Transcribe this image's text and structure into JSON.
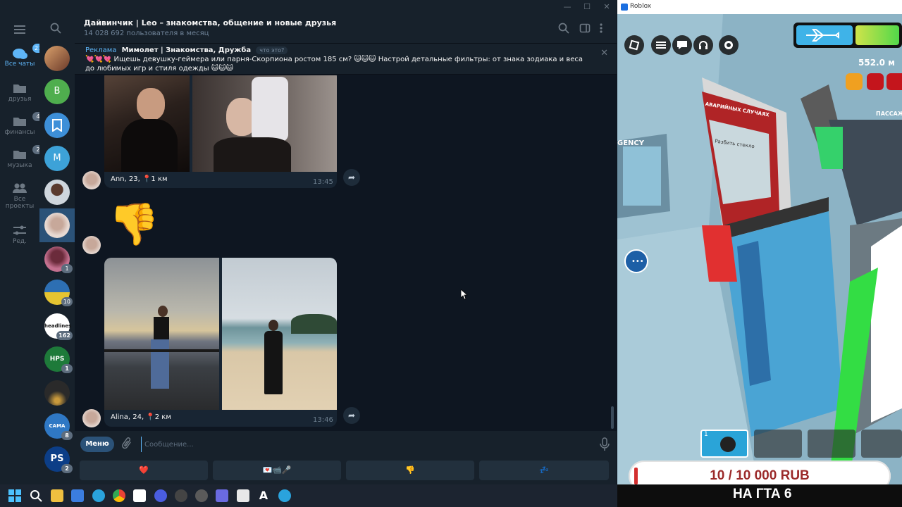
{
  "telegram": {
    "folders": [
      {
        "label": "Все чаты",
        "badge": "21",
        "icon": "chat-bubbles-icon",
        "active": true
      },
      {
        "label": "друзья",
        "badge": "",
        "icon": "folder-icon"
      },
      {
        "label": "финансы",
        "badge": "4",
        "icon": "folder-icon"
      },
      {
        "label": "музыка",
        "badge": "2",
        "icon": "folder-icon"
      },
      {
        "label": "Все проекты",
        "badge": "",
        "icon": "people-icon"
      },
      {
        "label": "Ред.",
        "badge": "",
        "icon": "sliders-icon"
      }
    ],
    "chat_list": [
      {
        "initial": "",
        "badge": "",
        "color": "#a0522d"
      },
      {
        "initial": "B",
        "badge": "",
        "color": "#4fae4e"
      },
      {
        "initial": "",
        "badge": "",
        "color": "#3d8fd8"
      },
      {
        "initial": "M",
        "badge": "",
        "color": "#3da2d8"
      },
      {
        "initial": "",
        "badge": "",
        "color": "#8a6b5a"
      },
      {
        "initial": "",
        "badge": "",
        "color": "#b9a59c"
      },
      {
        "initial": "",
        "badge": "1",
        "color": "#7a3b5e"
      },
      {
        "initial": "",
        "badge": "10",
        "color": "#2d6fb3"
      },
      {
        "initial": "headlines",
        "badge": "162",
        "color": "#ffffff"
      },
      {
        "initial": "HPS",
        "badge": "1",
        "color": "#1e7a3a"
      },
      {
        "initial": "",
        "badge": "",
        "color": "#3a3a3a"
      },
      {
        "initial": "CAMA",
        "badge": "8",
        "color": "#2f78c4"
      },
      {
        "initial": "PS",
        "badge": "2",
        "color": "#0c3e87"
      }
    ],
    "header": {
      "title": "Дайвинчик | Leo – знакомства, общение и новые друзья",
      "subtitle": "14 028 692 пользователя в месяц"
    },
    "ad": {
      "tag": "Реклама",
      "name": "Мимолет | Знакомства, Дружба",
      "what": "что это?",
      "text": "💘💘💘 Ищешь девушку-геймера или парня-Скорпиона ростом 185 см? 🐱🐱🐱 Настрой детальные фильтры: от знака зодиака и веса до любимых игр и стиля одежды 🐱🐱🐱"
    },
    "messages": [
      {
        "caption": "Ann, 23, 📍1 км",
        "time": "13:45"
      },
      {
        "emoji": "👎"
      },
      {
        "caption": "Alina, 24, 📍2 км",
        "time": "13:46"
      }
    ],
    "composer": {
      "menu_label": "Меню",
      "placeholder": "Сообщение..."
    },
    "keyboard": [
      "❤️",
      "💌📹🎤",
      "👎",
      "💤"
    ]
  },
  "roblox": {
    "window_title": "Roblox",
    "distance": "552.0 м",
    "sign_top": "АВАРИЙНЫХ СЛУЧАЯХ",
    "sign_break": "Разбить стекло",
    "sign_emergency": "GENCY",
    "sign_passenger": "ПАССАЖ",
    "money": "10 / 10 000 RUB",
    "overlay_text": "НА ГТА 6"
  }
}
